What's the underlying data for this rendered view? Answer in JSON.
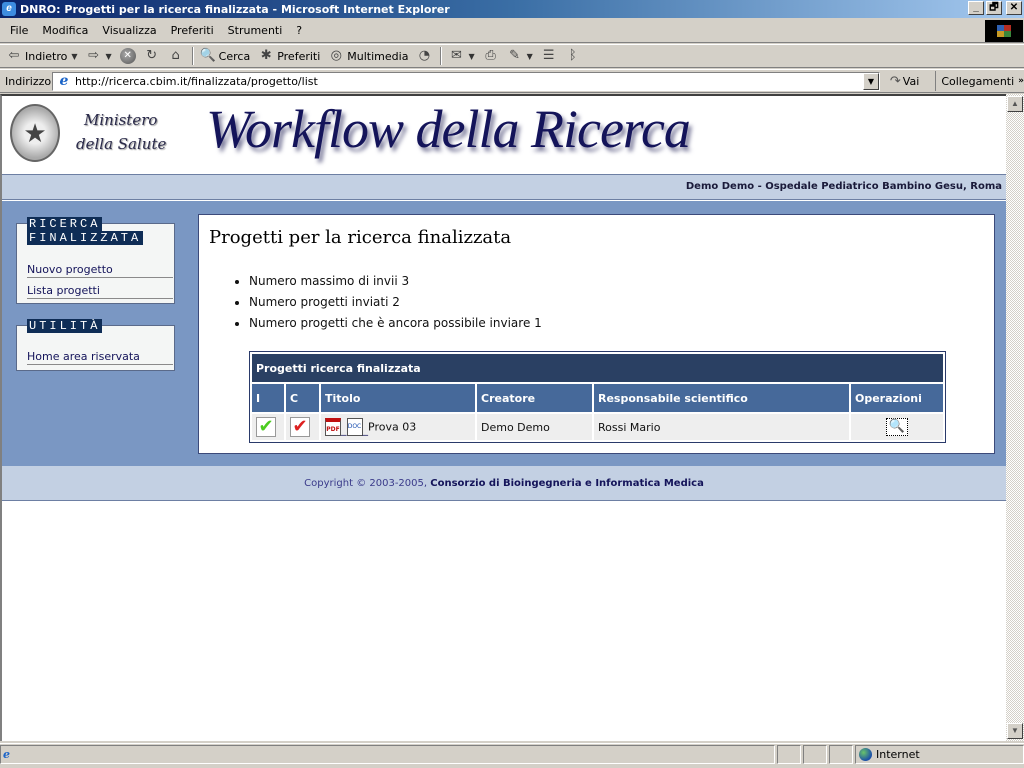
{
  "window": {
    "title": "DNRO: Progetti per la ricerca finalizzata - Microsoft Internet Explorer",
    "controls": {
      "minimize": "_",
      "restore": "🗗",
      "close": "✕"
    }
  },
  "menu": [
    "File",
    "Modifica",
    "Visualizza",
    "Preferiti",
    "Strumenti",
    "?"
  ],
  "toolbar": {
    "back_label": "Indietro",
    "search_label": "Cerca",
    "favorites_label": "Preferiti",
    "media_label": "Multimedia"
  },
  "address": {
    "label": "Indirizzo",
    "url": "http://ricerca.cbim.it/finalizzata/progetto/list",
    "go_label": "Vai",
    "links_label": "Collegamenti",
    "links_more": "»"
  },
  "header": {
    "ministry_line1": "Ministero",
    "ministry_line2": "della Salute",
    "site_title": "Workflow della Ricerca",
    "user_info": "Demo Demo - Ospedale Pediatrico Bambino Gesu, Roma"
  },
  "sidebar": {
    "section1": {
      "title_line1": "RICERCA",
      "title_line2": "FINALIZZATA",
      "links": [
        "Nuovo progetto",
        "Lista progetti"
      ]
    },
    "section2": {
      "title": "UTILITÀ",
      "links": [
        "Home area riservata"
      ]
    }
  },
  "content": {
    "title": "Progetti per la ricerca finalizzata",
    "info": [
      "Numero massimo di invii 3",
      "Numero progetti inviati 2",
      "Numero progetti che è ancora possibile inviare 1"
    ],
    "table": {
      "caption": "Progetti ricerca finalizzata",
      "headers": [
        "I",
        "C",
        "Titolo",
        "Creatore",
        "Responsabile scientifico",
        "Operazioni"
      ],
      "rows": [
        {
          "inviato": "✔",
          "completato": "✔",
          "titolo": "Prova 03",
          "pdf_icon": "PDF",
          "doc_icon": "DOC",
          "creatore": "Demo Demo",
          "responsabile": "Rossi Mario",
          "operation_icon": "🔍"
        }
      ]
    }
  },
  "footer": {
    "copyright": "Copyright © 2003-2005, ",
    "org": "Consorzio di Bioingegneria e Informatica Medica"
  },
  "statusbar": {
    "zone": "Internet"
  },
  "colors": {
    "title_navy": "#14145a",
    "band_blue": "#7a97c3",
    "light_band": "#c3d0e3",
    "table_caption": "#2a4063",
    "table_header": "#46699a",
    "sidebar_title_bg": "#0f2d56"
  }
}
